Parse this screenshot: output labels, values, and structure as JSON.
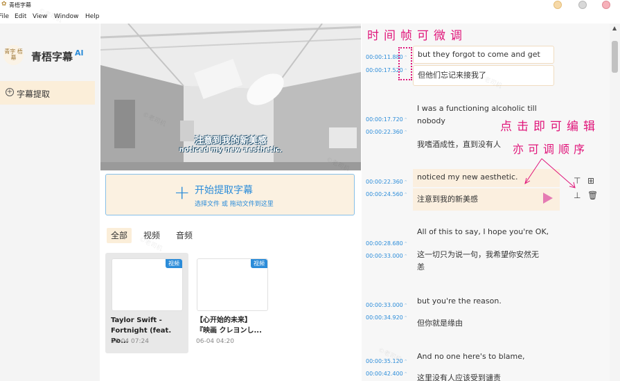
{
  "window": {
    "title": "青梧字幕",
    "app_glyph": "✿"
  },
  "menu": [
    "File",
    "Edit",
    "View",
    "Window",
    "Help"
  ],
  "sidebar": {
    "logo_text": "青字 梧幕",
    "app_name": "青梧字幕",
    "app_badge": "AI",
    "nav": [
      {
        "label": "字幕提取",
        "icon": "plus-circle-icon",
        "active": true
      }
    ]
  },
  "video": {
    "subtitle_cn": "注意到我的新美感",
    "subtitle_en": "noticed my new aesthetic."
  },
  "upload": {
    "title": "开始提取字幕",
    "hint": "选择文件 或 拖动文件到这里",
    "icon": "plus-icon"
  },
  "filters": [
    {
      "label": "全部",
      "active": true
    },
    {
      "label": "视频",
      "active": false
    },
    {
      "label": "音频",
      "active": false
    }
  ],
  "media": [
    {
      "badge": "视频",
      "title_line1": "Taylor Swift -",
      "title_line2": "Fortnight (feat. Po...",
      "date": "06-04 07:24"
    },
    {
      "badge": "视频",
      "title_line1": "【心开始的未来】",
      "title_line2": "『映画 クレヨンし...",
      "date": "06-04 04:20"
    }
  ],
  "subtitles": [
    {
      "start": "00:00:11.880",
      "end": "00:00:17.520",
      "en": "but they forgot to come and get me.",
      "cn": "但他们忘记来接我了"
    },
    {
      "start": "00:00:17.720",
      "end": "00:00:22.360",
      "en_line1": "I was a functioning alcoholic till",
      "en_line2": "nobody",
      "cn": "我嗜酒成性，直到没有人"
    },
    {
      "start": "00:00:22.360",
      "end": "00:00:24.560",
      "en": "noticed my new aesthetic.",
      "cn": "注意到我的新美感"
    },
    {
      "start": "00:00:28.680",
      "end": "00:00:33.000",
      "en": "All of this to say, I hope you're OK,",
      "cn_line1": "这一切只为说一句，我希望你安然无",
      "cn_line2": "恙"
    },
    {
      "start": "00:00:33.000",
      "end": "00:00:34.920",
      "en": "but you're the reason.",
      "cn": "但你就是缘由"
    },
    {
      "start": "00:00:35.120",
      "end": "00:00:42.400",
      "en": "And no one here's to blame,",
      "cn": "这里没有人应该受到谴责"
    }
  ],
  "row_actions": [
    "insert-above-icon",
    "merge-icon",
    "insert-below-icon",
    "delete-icon"
  ],
  "annotations": {
    "frame_tune": "时间帧可微调",
    "click_edit": "点击即可编辑",
    "reorder": "亦可调顺序"
  },
  "watermark": "©老司机"
}
